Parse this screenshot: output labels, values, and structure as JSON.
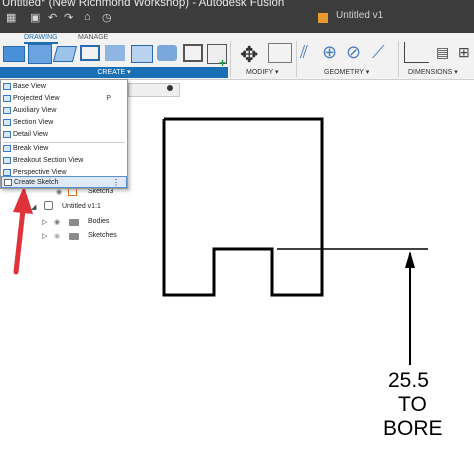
{
  "titlebar": {
    "title": "Untitled* (New Richmond Workshop) - Autodesk Fusion",
    "document_tab": "Untitled v1"
  },
  "ribbon": {
    "tabs": [
      "DRAWING",
      "MANAGE"
    ],
    "groups": [
      "CREATE",
      "MODIFY",
      "GEOMETRY",
      "DIMENSIONS"
    ]
  },
  "create_menu": {
    "items": [
      {
        "label": "Base View",
        "shortcut": ""
      },
      {
        "label": "Projected View",
        "shortcut": "P"
      },
      {
        "label": "Auxiliary View",
        "shortcut": ""
      },
      {
        "label": "Section View",
        "shortcut": ""
      },
      {
        "label": "Detail View",
        "shortcut": ""
      },
      {
        "label": "Break View",
        "shortcut": ""
      },
      {
        "label": "Breakout Section View",
        "shortcut": ""
      },
      {
        "label": "Perspective View",
        "shortcut": ""
      },
      {
        "label": "Create Sketch",
        "shortcut": ""
      }
    ]
  },
  "browser": {
    "sketch_item": "Sketch3",
    "component": "Untitled v1:1",
    "folders": [
      "Bodies",
      "Sketches"
    ]
  },
  "annotation": {
    "line1": "25.5",
    "line2": "TO",
    "line3": "BORE"
  },
  "colors": {
    "accent": "#1a6fb5",
    "arrow_red": "#e0323a",
    "titlebar": "#3c3c3c"
  }
}
